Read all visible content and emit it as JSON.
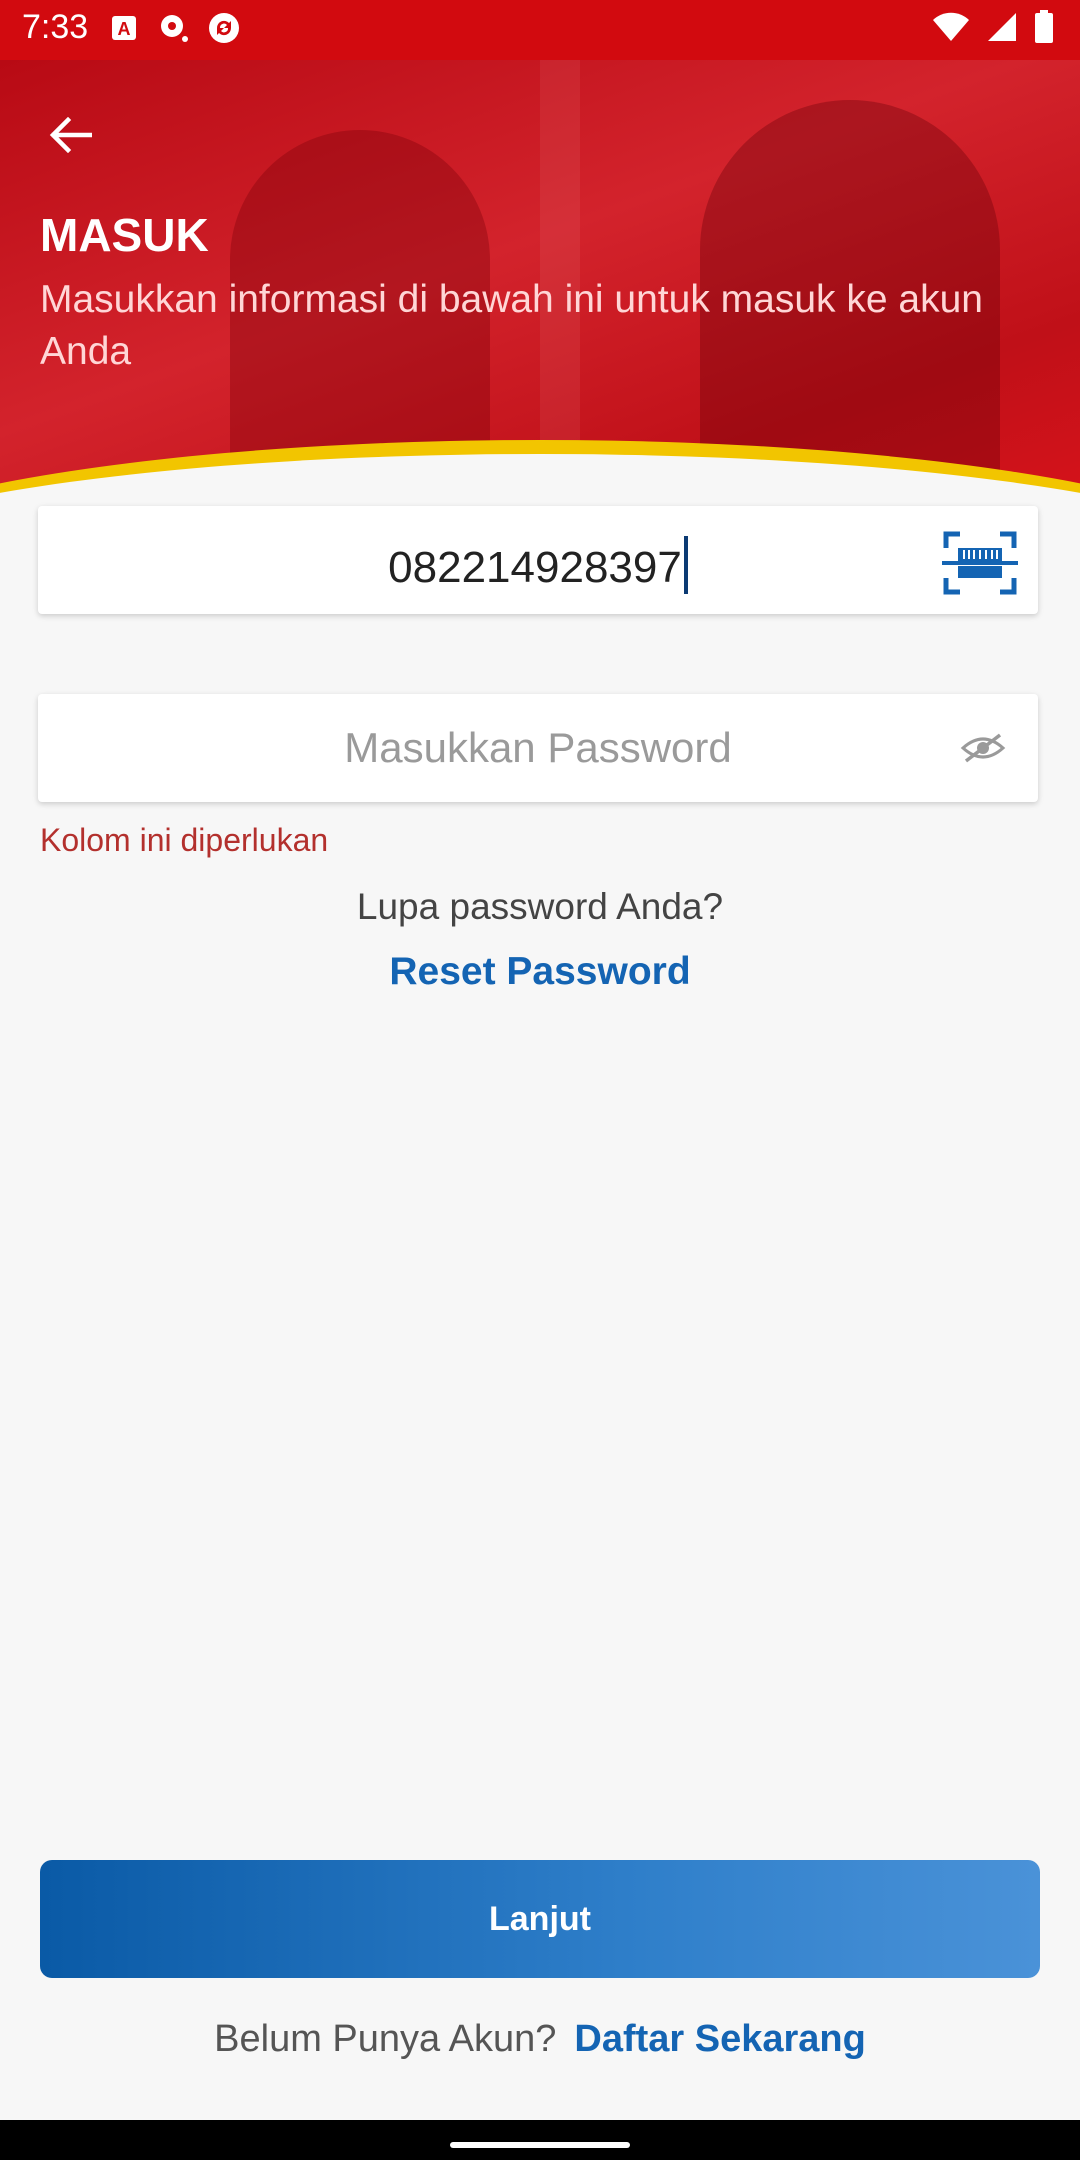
{
  "status": {
    "time": "7:33"
  },
  "header": {
    "title": "MASUK",
    "subtitle": "Masukkan informasi di bawah ini untuk masuk ke akun Anda"
  },
  "form": {
    "phone_value": "082214928397",
    "password_placeholder": "Masukkan Password",
    "error_text": "Kolom ini diperlukan",
    "forgot_text": "Lupa password Anda?",
    "reset_label": "Reset Password"
  },
  "actions": {
    "submit_label": "Lanjut",
    "register_prompt": "Belum Punya Akun?",
    "register_link": "Daftar Sekarang"
  },
  "colors": {
    "brand_red": "#d20a0f",
    "accent_yellow": "#f2c500",
    "link_blue": "#1464b3",
    "error_red": "#b3302d"
  },
  "icons": [
    "back-arrow-icon",
    "barcode-scan-icon",
    "eye-hidden-icon"
  ]
}
